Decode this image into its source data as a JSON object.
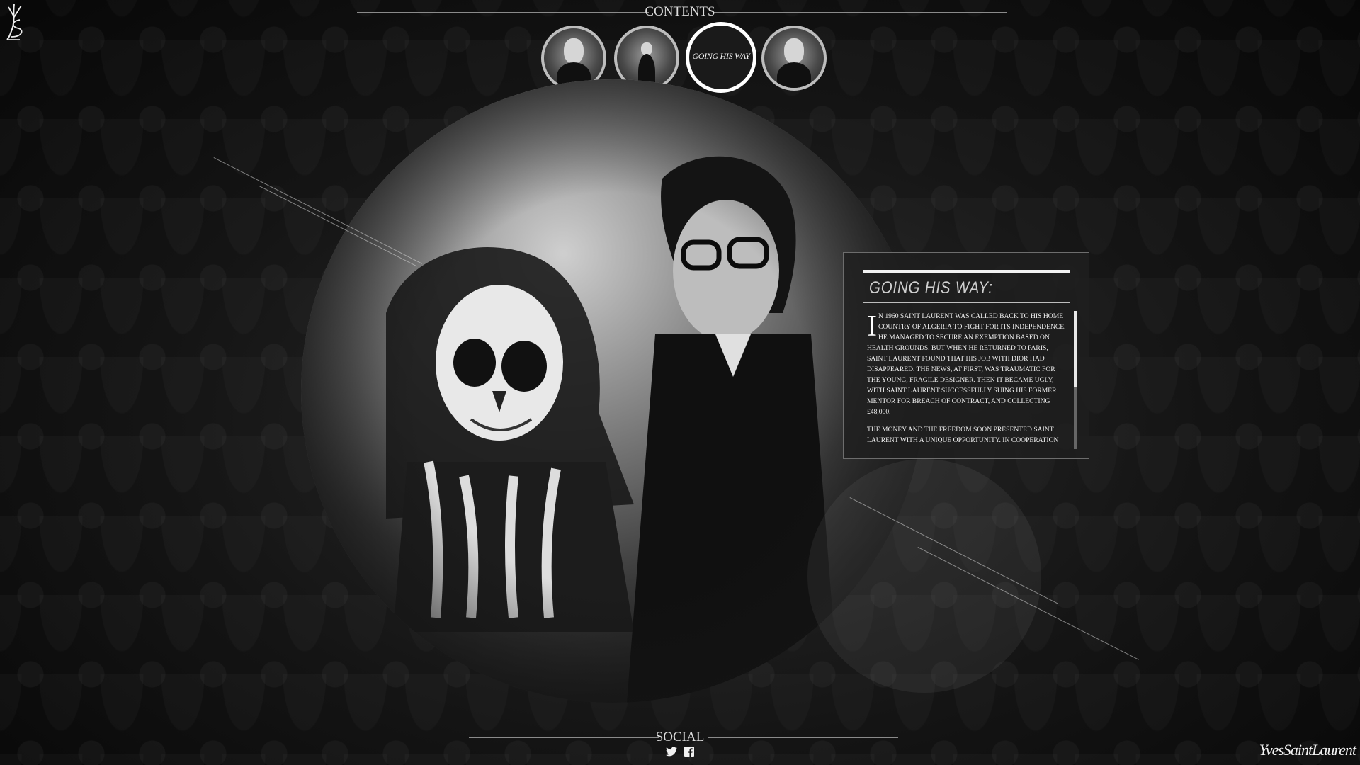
{
  "header": {
    "contents_label": "CONTENTS",
    "thumbnails": [
      {
        "name": "portrait-1"
      },
      {
        "name": "portrait-2"
      },
      {
        "name": "going-his-way",
        "label": "GOING HIS WAY",
        "active": true
      },
      {
        "name": "portrait-4"
      }
    ]
  },
  "article": {
    "title": "GOING HIS WAY:",
    "dropcap": "I",
    "paragraph1": "n 1960 Saint Laurent was called back to his home country of Algeria to fight for its independence. He managed to secure an exemption based on health grounds, but when he returned to Paris, Saint Laurent found that his job with Dior had disappeared. The news, at first, was traumatic for the young, fragile designer. Then it became ugly, with Saint Laurent successfully suing his former mentor for breach of contract, and collecting £48,000.",
    "paragraph2": "The money and the freedom soon presented Saint Laurent with a unique opportunity. In cooperation"
  },
  "footer": {
    "social_label": "SOCIAL",
    "signature": "YvesSaintLaurent"
  },
  "colors": {
    "background": "#141414",
    "accent": "#ffffff",
    "line": "#8a8a8a"
  }
}
